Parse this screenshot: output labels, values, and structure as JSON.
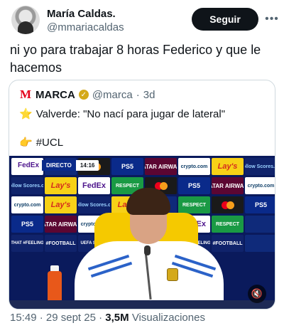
{
  "author": {
    "name": "María Caldas.",
    "handle": "@mmariacaldas"
  },
  "follow_label": "Seguir",
  "more_icon": "more-horizontal-icon",
  "tweet_text": "ni yo para trabajar 8 horas Federico y que le hacemos",
  "quote": {
    "name": "MARCA",
    "handle": "@marca",
    "separator": "·",
    "age": "3d",
    "line1": "Valverde: \"No nací para jugar de lateral\"",
    "line1_emoji": "⭐",
    "line2": "#UCL",
    "line2_emoji": "👉",
    "verified_icon": "verified-gold-badge-icon",
    "logo_icon": "marca-logo-icon",
    "logo_letter": "M"
  },
  "video": {
    "scoreboard": {
      "brand": "FedEx",
      "live_label": "DIRECTO",
      "time": "14:16"
    },
    "mute_icon": "volume-mute-icon",
    "sponsors": [
      "FedEx",
      "",
      "mastercard",
      "PS5",
      "QATAR AIRWAYS",
      "crypto.com",
      "Lay's",
      "#Follow Scores.com",
      "#Follow Scores.com",
      "Lay's",
      "FedEx",
      "RESPECT",
      "mastercard",
      "PS5",
      "QATAR AIRWAYS",
      "crypto.com",
      "crypto.com",
      "Lay's",
      "#Follow Scores.com",
      "Lay's",
      "",
      "RESPECT",
      "mastercard",
      "PS5",
      "PS5",
      "QATAR AIRWAYS",
      "crypto.com",
      "",
      "",
      "FedEx",
      "RESPECT",
      "",
      "THAT #FEELING",
      "#FOOTBALL",
      "UEFA SPORT",
      "",
      "",
      "THAT #FEELING",
      "#FOOTBALL",
      ""
    ]
  },
  "footer": {
    "time": "15:49",
    "separator": "·",
    "date": "29 sept 25",
    "separator2": "·",
    "views": "3,5M",
    "views_label": "Visualizaciones"
  },
  "colors": {
    "text": "#0f1419",
    "muted": "#536471",
    "border": "#cfd9de",
    "marca_red": "#e4001b",
    "verified_gold": "#d4a91a"
  }
}
